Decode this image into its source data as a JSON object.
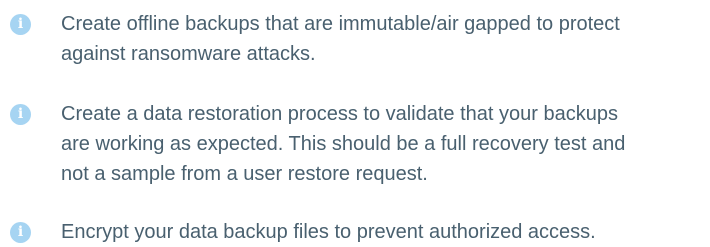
{
  "tips": [
    {
      "icon": "info-icon",
      "lines": [
        "Create offline backups that are immutable/air gapped to protect",
        "against ransomware attacks."
      ]
    },
    {
      "icon": "info-icon",
      "lines": [
        "Create a data restoration process to validate that your backups",
        "are working as expected. This should be a full recovery test and",
        "not a sample from a user restore request."
      ]
    },
    {
      "icon": "info-icon",
      "lines": [
        "Encrypt your data backup files to prevent authorized access."
      ]
    }
  ],
  "colors": {
    "icon_background": "#a6d4f2",
    "icon_glyph": "#ffffff",
    "text": "#49606f"
  }
}
